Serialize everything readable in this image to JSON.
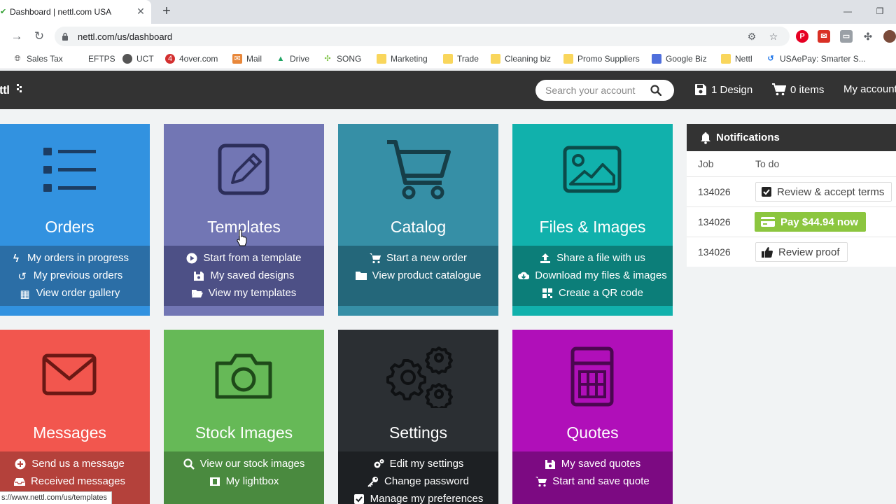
{
  "browser": {
    "tab_title": "Dashboard | nettl.com USA",
    "url": "nettl.com/us/dashboard",
    "bookmarks": [
      {
        "label": "Sales Tax",
        "icon": "globe-icon"
      },
      {
        "label": "EFTPS",
        "icon": "blank-icon"
      },
      {
        "label": "UCT",
        "icon": "globe-icon"
      },
      {
        "label": "4over.com",
        "icon": "4over-icon"
      },
      {
        "label": "Mail",
        "icon": "mail-icon"
      },
      {
        "label": "Drive",
        "icon": "drive-icon"
      },
      {
        "label": "SONG",
        "icon": "song-icon"
      },
      {
        "label": "Marketing",
        "icon": "folder-icon"
      },
      {
        "label": "Trade",
        "icon": "folder-icon"
      },
      {
        "label": "Cleaning biz",
        "icon": "folder-icon"
      },
      {
        "label": "Promo Suppliers",
        "icon": "folder-icon"
      },
      {
        "label": "Google Biz",
        "icon": "google-biz-icon"
      },
      {
        "label": "Nettl",
        "icon": "folder-icon"
      },
      {
        "label": "USAePay: Smarter S...",
        "icon": "usaepay-icon"
      }
    ],
    "status_url": "https://www.nettl.com/us/templates",
    "status_visible": "s://www.nettl.com/us/templates"
  },
  "header": {
    "logo": "nettl",
    "search_placeholder": "Search your account",
    "design": "1 Design",
    "items": "0 items",
    "account": "My account"
  },
  "tiles": [
    {
      "name": "Orders",
      "color": "#3292e0",
      "links": [
        "My orders in progress",
        "My previous orders",
        "View order gallery"
      ]
    },
    {
      "name": "Templates",
      "color": "#7276b4",
      "links": [
        "Start from a template",
        "My saved designs",
        "View my templates"
      ]
    },
    {
      "name": "Catalog",
      "color": "#368fa6",
      "links": [
        "Start a new order",
        "View product catalogue"
      ]
    },
    {
      "name": "Files & Images",
      "color": "#11b1ac",
      "links": [
        "Share a file with us",
        "Download my files & images",
        "Create a QR code"
      ]
    },
    {
      "name": "Messages",
      "color": "#f2564e",
      "links": [
        "Send us a message",
        "Received messages"
      ]
    },
    {
      "name": "Stock Images",
      "color": "#66b957",
      "links": [
        "View our stock images",
        "My lightbox"
      ]
    },
    {
      "name": "Settings",
      "color": "#2b2f33",
      "links": [
        "Edit my settings",
        "Change password",
        "Manage my preferences"
      ]
    },
    {
      "name": "Quotes",
      "color": "#b00fb9",
      "links": [
        "My saved quotes",
        "Start and save quote"
      ]
    }
  ],
  "notifications": {
    "title": "Notifications",
    "col_job": "Job",
    "col_todo": "To do",
    "rows": [
      {
        "job": "134026",
        "todo": "Review & accept terms",
        "icon": "checkbox-icon"
      },
      {
        "job": "134026",
        "todo": "Pay $44.94 now",
        "icon": "credit-card-icon"
      },
      {
        "job": "134026",
        "todo": "Review proof",
        "icon": "thumbs-up-icon"
      }
    ]
  }
}
